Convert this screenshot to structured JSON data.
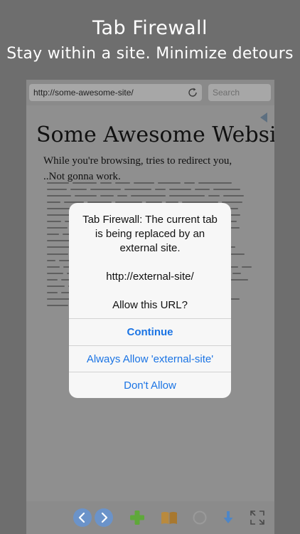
{
  "promo": {
    "title": "Tab Firewall",
    "subtitle": "Stay within a site. Minimize detours"
  },
  "browser": {
    "url_value": "http://some-awesome-site/",
    "search_placeholder": "Search",
    "page": {
      "heading": "Some Awesome Website",
      "line1": "While you're browsing, tries to redirect you,",
      "line2": "..Not gonna work."
    },
    "bottom_toolbar": [
      "back-icon",
      "forward-icon",
      "add-icon",
      "bookmarks-icon",
      "stop-icon",
      "download-icon",
      "fullscreen-icon"
    ]
  },
  "alert": {
    "message_lines": [
      "Tab Firewall: The current tab",
      "is being replaced by an",
      "external site.",
      "",
      "http://external-site/",
      "",
      "Allow this URL?"
    ],
    "buttons": {
      "continue": "Continue",
      "always_allow": "Always Allow 'external-site'",
      "dont_allow": "Don't Allow"
    }
  },
  "colors": {
    "accent": "#1b74e4",
    "overlay": "#8f8f8f",
    "add_green": "#5fa83a"
  }
}
